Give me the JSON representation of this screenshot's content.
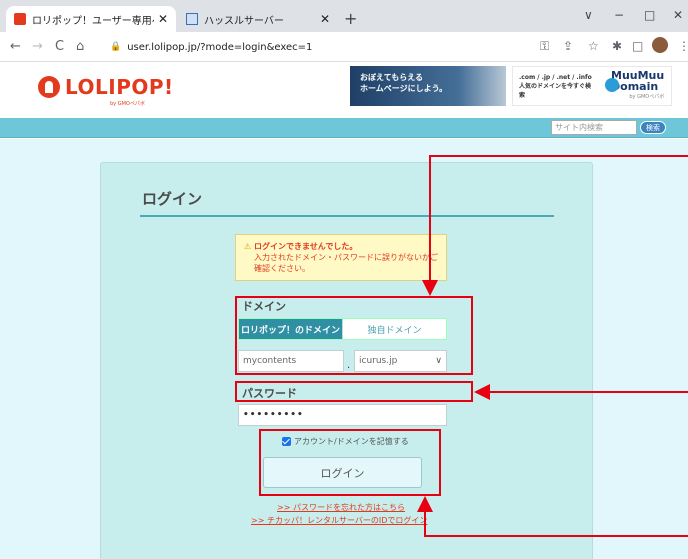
{
  "browser": {
    "tabs": [
      {
        "title": "ロリポップ！ユーザー専用ページ",
        "active": true
      },
      {
        "title": "ハッスルサーバー",
        "active": false
      }
    ],
    "new_tab_label": "+",
    "window": {
      "minimize": "−",
      "maximize": "□",
      "close": "✕",
      "dropdown": "∨"
    },
    "url": "user.lolipop.jp/?mode=login&exec=1",
    "nav": {
      "back": "←",
      "forward": "→",
      "reload": "C",
      "home": "⌂"
    },
    "extension_icons": [
      "key-icon",
      "share-icon",
      "star-icon",
      "puzzle-icon",
      "sidepanel-icon",
      "profile-avatar-icon",
      "menu-icon"
    ]
  },
  "site": {
    "logo_text": "LOLIPOP!",
    "logo_sub": "by GMOペパボ",
    "banner1": {
      "line1": "おぼえてもらえる",
      "line2": "ホームページにしよう。"
    },
    "banner2": {
      "line1": ".com / .jp / .net / .info",
      "line2": "人気のドメインを今すぐ検索",
      "brand1": "MuuMuu",
      "brand2": "Domain",
      "brand_sub": "by GMOペパボ"
    },
    "search_placeholder": "サイト内検索",
    "search_button": "検索"
  },
  "login": {
    "title": "ログイン",
    "error_head": "ログインできませんでした。",
    "error_body": "入力されたドメイン・パスワードに誤りがないかご確認ください。",
    "domain_label": "ドメイン",
    "domain_tabs": [
      "ロリポップ！のドメイン",
      "独自ドメイン"
    ],
    "subdomain_value": "mycontents",
    "domain_select": "icurus.jp",
    "password_label": "パスワード",
    "password_value": "•••••••••",
    "remember_label": "アカウント/ドメインを記憶する",
    "login_button": "ログイン",
    "forgot_link": ">> パスワードを忘れた方はこちら",
    "chikappa_link": ">> チカッパ！レンタルサーバーのIDでログイン"
  },
  "colors": {
    "brand": "#e33a1d",
    "accent_teal": "#2f8fa3",
    "annotation": "#e60012"
  }
}
